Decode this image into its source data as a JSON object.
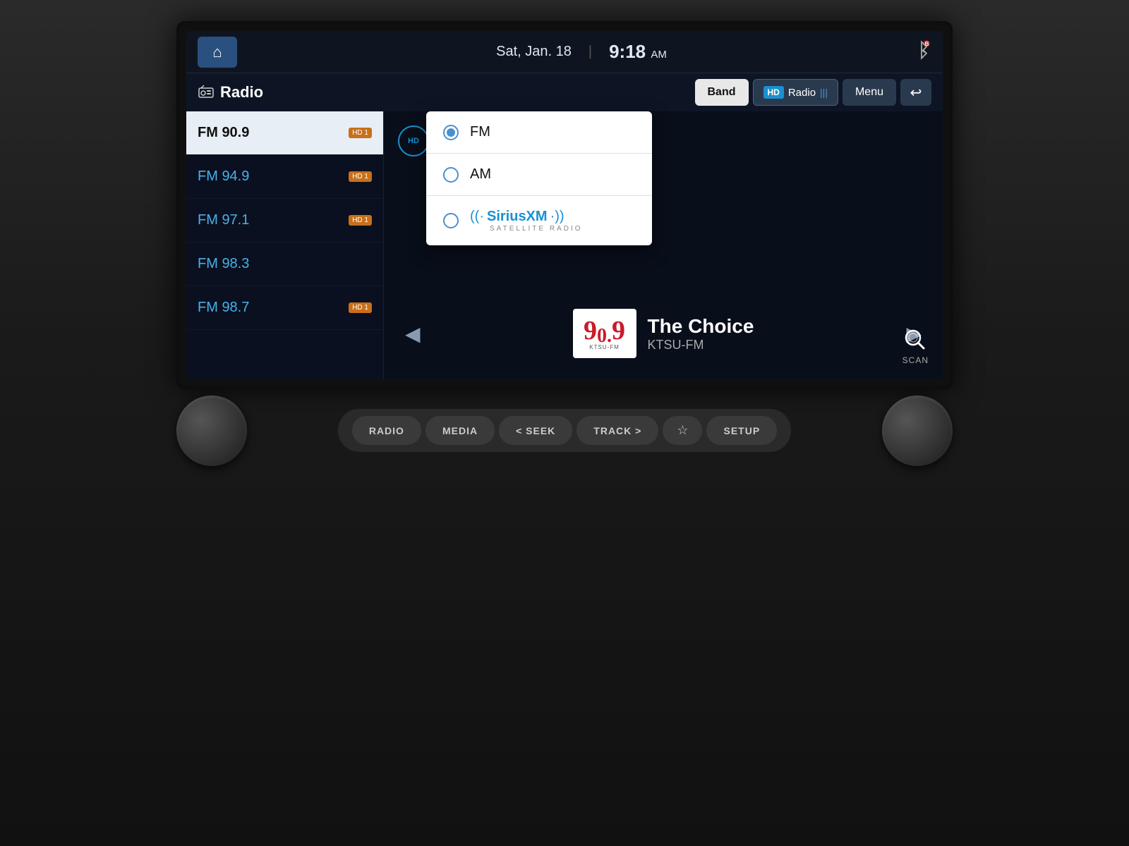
{
  "header": {
    "home_label": "🏠",
    "date": "Sat, Jan. 18",
    "time": "9:18",
    "ampm": "AM",
    "bluetooth_icon": "⊕"
  },
  "toolbar": {
    "radio_label": "Radio",
    "radio_icon": "📻",
    "band_btn": "Band",
    "hd_radio_btn": "HD Radio",
    "hd_badge": "HD",
    "menu_btn": "Menu",
    "back_btn": "↩"
  },
  "band_dropdown": {
    "options": [
      {
        "id": "fm",
        "label": "FM",
        "selected": true
      },
      {
        "id": "am",
        "label": "AM",
        "selected": false
      },
      {
        "id": "sirius",
        "label": "SiriusXM",
        "selected": false
      }
    ]
  },
  "station_list": {
    "stations": [
      {
        "band": "FM",
        "freq": "90.9",
        "active": true,
        "hd": true
      },
      {
        "band": "FM",
        "freq": "94.9",
        "active": false,
        "hd": true
      },
      {
        "band": "FM",
        "freq": "97.1",
        "active": false,
        "hd": true
      },
      {
        "band": "FM",
        "freq": "98.3",
        "active": false,
        "hd": false
      },
      {
        "band": "FM",
        "freq": "98.7",
        "active": false,
        "hd": true
      }
    ]
  },
  "now_playing": {
    "station": "The Choice",
    "call_sign": "KTSU-FM",
    "logo_main": "90.9",
    "logo_sub": "KTSU-FM"
  },
  "scan": {
    "label": "SCAN"
  },
  "physical_buttons": {
    "radio": "RADIO",
    "media": "MEDIA",
    "seek_back": "< SEEK",
    "track": "TRACK >",
    "favorite": "☆",
    "setup": "SETUP"
  }
}
